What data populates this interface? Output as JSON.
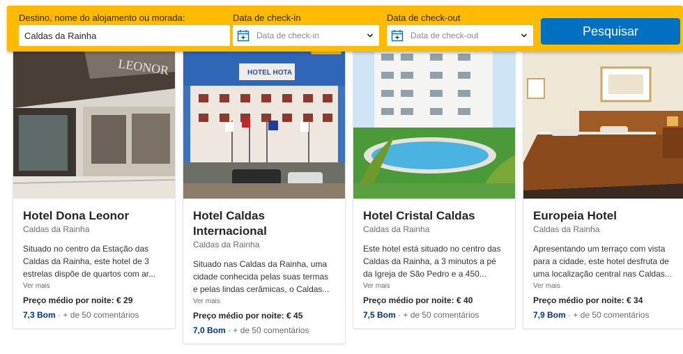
{
  "search": {
    "destination_label": "Destino, nome do alojamento ou morada:",
    "destination_value": "Caldas da Rainha",
    "checkin_label": "Data de check-in",
    "checkin_placeholder": "Data de check-in",
    "checkout_label": "Data de check-out",
    "checkout_placeholder": "Data de check-out",
    "search_button": "Pesquisar"
  },
  "colors": {
    "search_bar": "#febb02",
    "search_button": "#0071c2",
    "score": "#003580"
  },
  "hotels": [
    {
      "name": "Hotel Dona Leonor",
      "location": "Caldas da Rainha",
      "description": "Situado no centro da Estação das Caldas da Rainha, este hotel de 3 estrelas dispõe de quartos com ar...",
      "more": "Ver mais",
      "price": "Preço médio por noite: € 29",
      "score": "7,3 Bom",
      "reviews": " · + de 50 comentários"
    },
    {
      "name": "Hotel Caldas Internacional",
      "location": "Caldas da Rainha",
      "description": "Situado nas Caldas da Rainha, uma cidade conhecida pelas suas termas e pelas lindas cerâmicas, o Caldas...",
      "more": "Ver mais",
      "price": "Preço médio por noite: € 45",
      "score": "7,0 Bom",
      "reviews": " · + de 50 comentários"
    },
    {
      "name": "Hotel Cristal Caldas",
      "location": "Caldas da Rainha",
      "description": "Este hotel está situado no centro das Caldas da Rainha, a 3 minutos a pé da Igreja de São Pedro e a 450...",
      "more": "Ver mais",
      "price": "Preço médio por noite: € 40",
      "score": "7,5 Bom",
      "reviews": " · + de 50 comentários"
    },
    {
      "name": "Europeia Hotel",
      "location": "Caldas da Rainha",
      "description": "Apresentando um terraço com vista para a cidade, este hotel desfruta de uma localização central nas Caldas...",
      "more": "Ver mais",
      "price": "Preço médio por noite: € 34",
      "score": "7,9 Bom",
      "reviews": " · + de 50 comentários"
    }
  ]
}
